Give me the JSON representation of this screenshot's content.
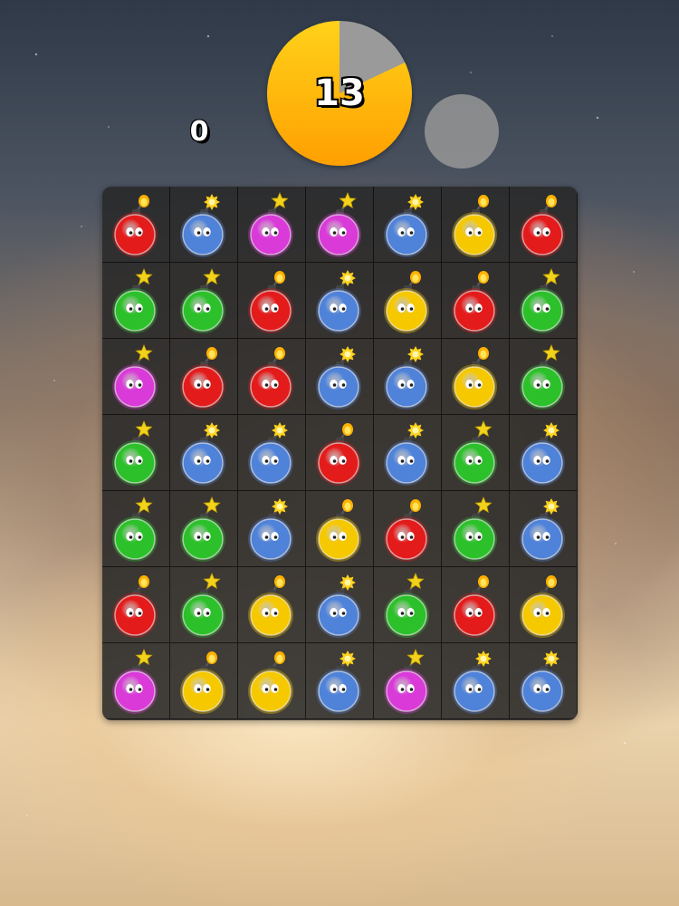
{
  "hud": {
    "score": "0",
    "timer": "13",
    "timer_remaining_fraction": 0.82,
    "timer_fill_colors": [
      "#ffd21a",
      "#ff9f00"
    ],
    "timer_empty_color": "#9a9a9a"
  },
  "colors": {
    "red": "#e41b1b",
    "blue": "#4f82d9",
    "magenta": "#d93ad8",
    "green": "#2cc12a",
    "yellow": "#f5c800"
  },
  "fuse_types": {
    "red": "flame",
    "blue": "spark",
    "magenta": "star",
    "green": "star",
    "yellow": "flame"
  },
  "board": {
    "rows": [
      [
        "red",
        "blue",
        "magenta",
        "magenta",
        "blue",
        "yellow",
        "red"
      ],
      [
        "green",
        "green",
        "red",
        "blue",
        "yellow",
        "red",
        "green"
      ],
      [
        "magenta",
        "red",
        "red",
        "blue",
        "blue",
        "yellow",
        "green"
      ],
      [
        "green",
        "blue",
        "blue",
        "red",
        "blue",
        "green",
        "blue"
      ],
      [
        "green",
        "green",
        "blue",
        "yellow",
        "red",
        "green",
        "blue"
      ],
      [
        "red",
        "green",
        "yellow",
        "blue",
        "green",
        "red",
        "yellow"
      ],
      [
        "magenta",
        "yellow",
        "yellow",
        "blue",
        "magenta",
        "blue",
        "blue"
      ]
    ]
  }
}
